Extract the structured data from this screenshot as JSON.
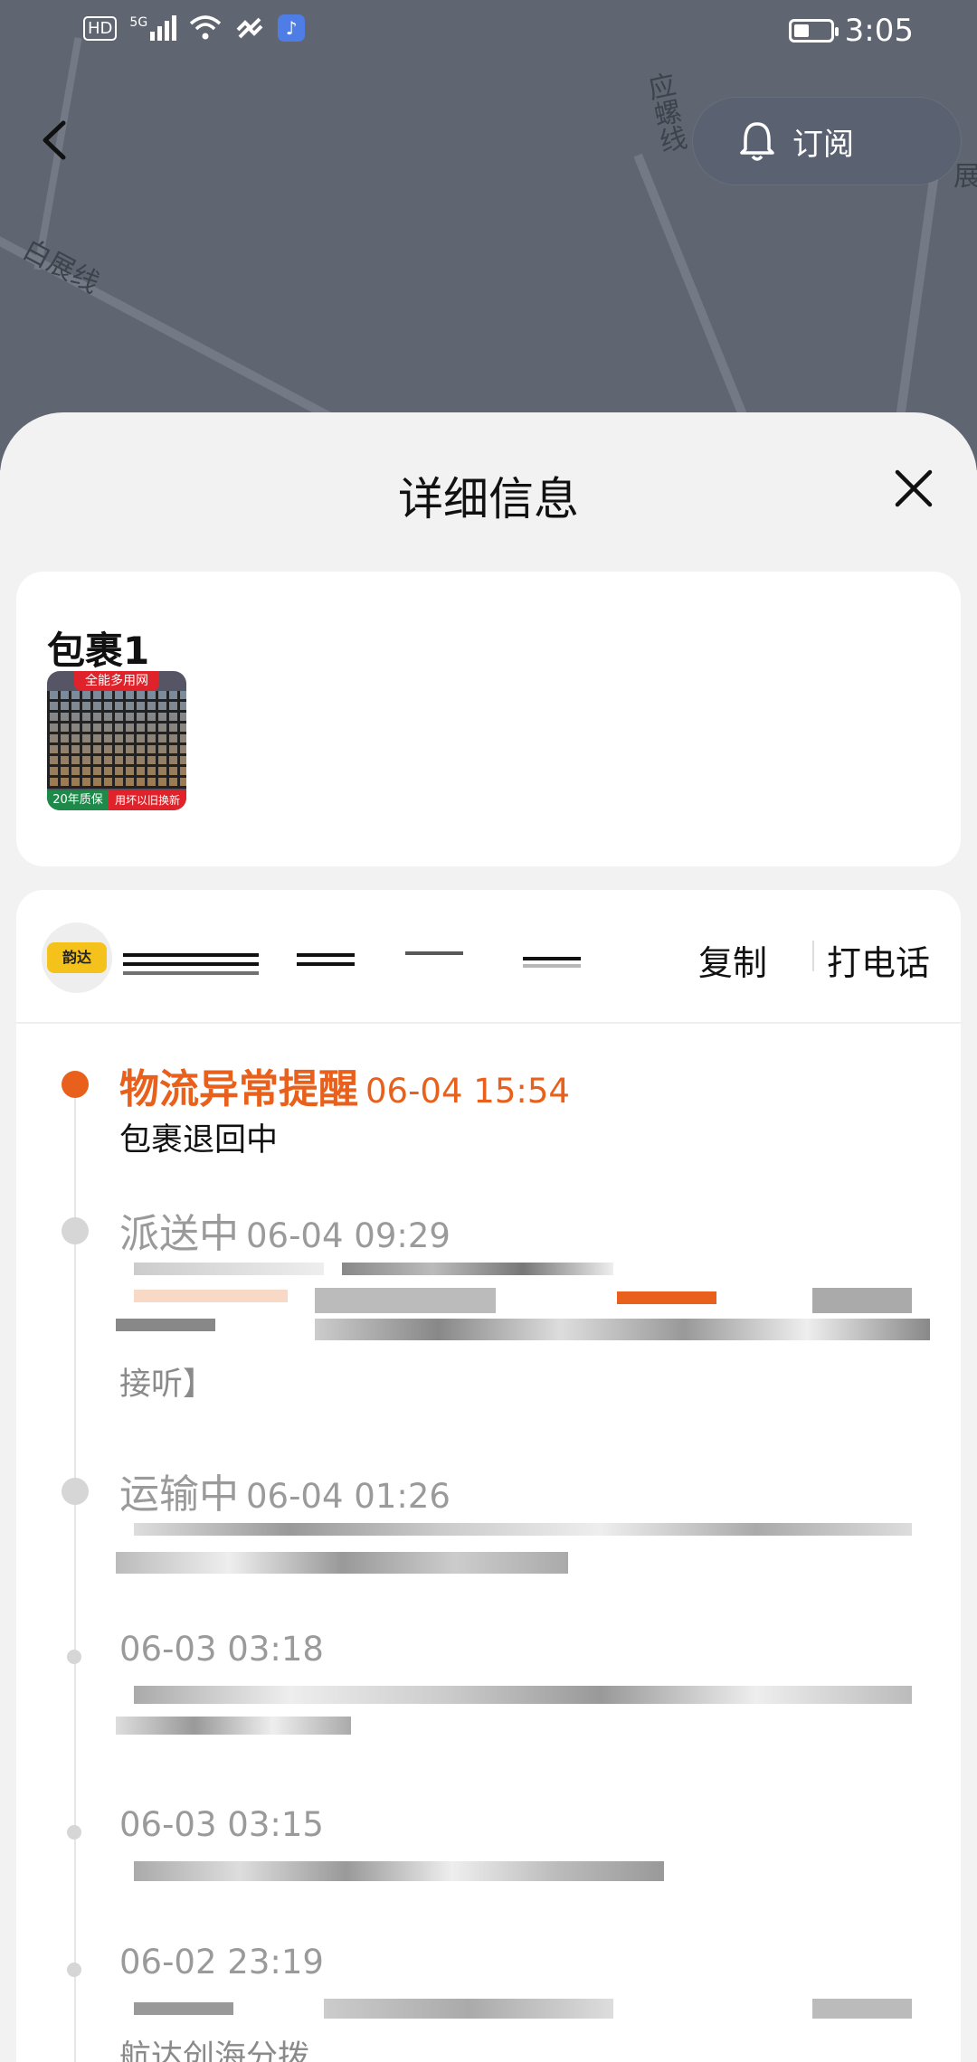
{
  "status_bar": {
    "hd": "HD",
    "network": "5G",
    "time": "3:05"
  },
  "map": {
    "labels": [
      "白展线",
      "应螺线",
      "展"
    ]
  },
  "header": {
    "subscribe_label": "订阅"
  },
  "sheet": {
    "title": "详细信息"
  },
  "package": {
    "title": "包裹1",
    "thumbnail": {
      "banner": "全能多用网",
      "footer_left": "20年质保",
      "footer_right": "用坏以旧换新"
    }
  },
  "carrier": {
    "logo_text": "韵达",
    "copy_label": "复制",
    "call_label": "打电话"
  },
  "timeline": [
    {
      "status": "物流异常提醒",
      "time": "06-04 15:54",
      "detail": "包裹退回中",
      "state": "active"
    },
    {
      "status": "派送中",
      "time": "06-04 09:29",
      "detail_tail": "接听】",
      "state": "past"
    },
    {
      "status": "运输中",
      "time": "06-04 01:26",
      "state": "past"
    },
    {
      "status": "",
      "time": "06-03 03:18",
      "state": "minor"
    },
    {
      "status": "",
      "time": "06-03 03:15",
      "state": "minor"
    },
    {
      "status": "",
      "time": "06-02 23:19",
      "detail_tail": "航达创海分拨",
      "state": "minor"
    }
  ],
  "colors": {
    "accent": "#e8601c",
    "muted": "#9a9a9a",
    "map": "#5f6672"
  }
}
